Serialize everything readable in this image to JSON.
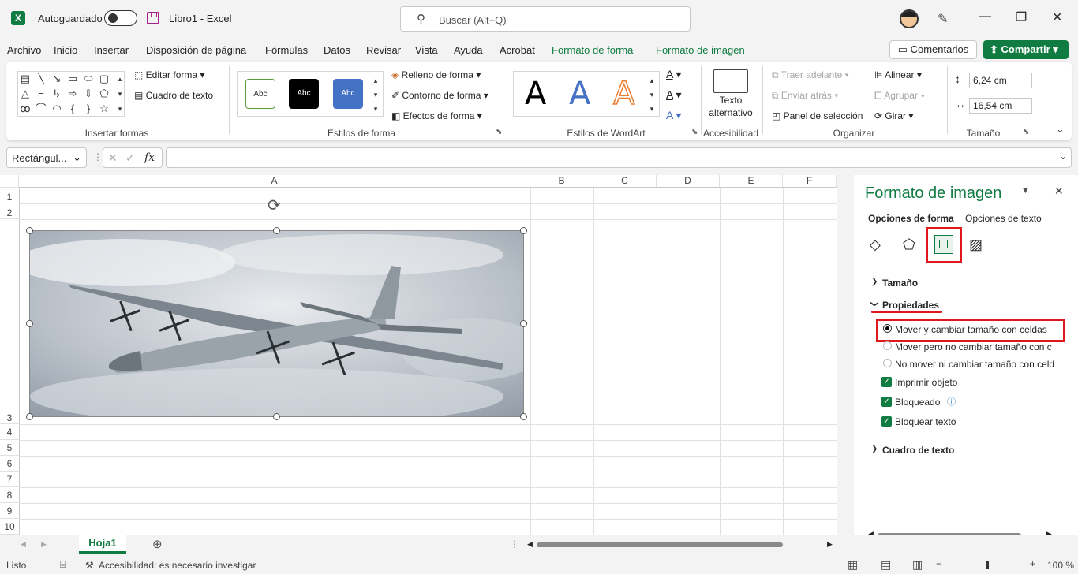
{
  "titlebar": {
    "autosave_label": "Autoguardado",
    "book_title": "Libro1  -  Excel",
    "search_placeholder": "Buscar (Alt+Q)",
    "min_icon": "minimize-icon",
    "restore_icon": "restore-icon",
    "close_icon": "close-icon"
  },
  "menu": {
    "items": [
      "Archivo",
      "Inicio",
      "Insertar",
      "Disposición de página",
      "Fórmulas",
      "Datos",
      "Revisar",
      "Vista",
      "Ayuda",
      "Acrobat",
      "Formato de forma",
      "Formato de imagen"
    ],
    "active": "Formato de forma",
    "comments": "Comentarios",
    "share": "Compartir"
  },
  "ribbon": {
    "insert_shapes": {
      "title": "Insertar formas",
      "edit_shape": "Editar forma",
      "text_box": "Cuadro de texto"
    },
    "shape_styles": {
      "title": "Estilos de forma",
      "sample": "Abc",
      "fill": "Relleno de forma",
      "outline": "Contorno de forma",
      "effects": "Efectos de forma"
    },
    "wordart": {
      "title": "Estilos de WordArt",
      "letter": "A"
    },
    "accessibility": {
      "title": "Accesibilidad",
      "alt_text_1": "Texto",
      "alt_text_2": "alternativo"
    },
    "arrange": {
      "title": "Organizar",
      "bring_forward": "Traer adelante",
      "send_backward": "Enviar atrás",
      "selection_pane": "Panel de selección",
      "align": "Alinear",
      "group": "Agrupar",
      "rotate": "Girar"
    },
    "size": {
      "title": "Tamaño",
      "height": "6,24 cm",
      "width": "16,54 cm"
    }
  },
  "formula_bar": {
    "name_box": "Rectángul...",
    "fx": "fx",
    "value": ""
  },
  "sheet": {
    "columns": [
      "A",
      "B",
      "C",
      "D",
      "E",
      "F"
    ],
    "rows": [
      "1",
      "2",
      "3",
      "4",
      "5",
      "6",
      "7",
      "8",
      "9",
      "10"
    ]
  },
  "pane": {
    "title": "Formato de imagen",
    "tab_shape": "Opciones de forma",
    "tab_text": "Opciones de texto",
    "section_size": "Tamaño",
    "section_props": "Propiedades",
    "section_textbox": "Cuadro de texto",
    "radio_1": "Mover y cambiar tamaño con celdas",
    "radio_2": "Mover pero no cambiar tamaño con c",
    "radio_3": "No mover ni cambiar tamaño con celd",
    "check_1": "Imprimir objeto",
    "check_2": "Bloqueado",
    "check_3": "Bloquear texto"
  },
  "tabs": {
    "sheet1": "Hoja1"
  },
  "status": {
    "ready": "Listo",
    "accessibility": "Accesibilidad: es necesario investigar",
    "zoom": "100 %"
  },
  "colors": {
    "accent": "#107c41",
    "highlight": "#e0181e"
  }
}
